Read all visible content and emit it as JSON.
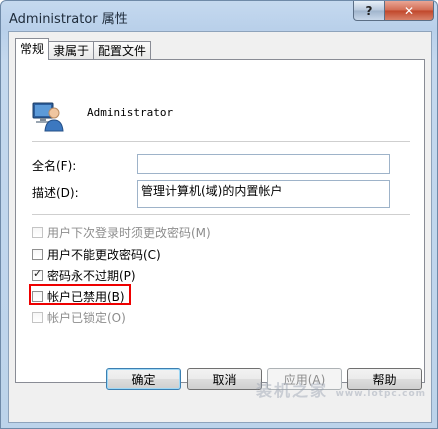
{
  "window": {
    "title": "Administrator 属性",
    "help_label": "?",
    "close_label": "✕"
  },
  "tabs": [
    {
      "label": "常规",
      "active": true
    },
    {
      "label": "隶属于",
      "active": false
    },
    {
      "label": "配置文件",
      "active": false
    }
  ],
  "user": {
    "name": "Administrator"
  },
  "form": {
    "fullname_label": "全名(F):",
    "fullname_value": "",
    "description_label": "描述(D):",
    "description_value": "管理计算机(域)的内置帐户"
  },
  "checkboxes": [
    {
      "label": "用户下次登录时须更改密码(M)",
      "checked": false,
      "disabled": true
    },
    {
      "label": "用户不能更改密码(C)",
      "checked": false,
      "disabled": false
    },
    {
      "label": "密码永不过期(P)",
      "checked": true,
      "disabled": false
    },
    {
      "label": "帐户已禁用(B)",
      "checked": false,
      "disabled": false
    },
    {
      "label": "帐户已锁定(O)",
      "checked": false,
      "disabled": true
    }
  ],
  "buttons": {
    "ok": "确定",
    "cancel": "取消",
    "apply": "应用(A)",
    "help": "帮助"
  },
  "watermark": {
    "text": "装机之家",
    "url": "www.lotpc.com"
  },
  "colors": {
    "highlight": "#e00000",
    "title_bar": "#c5d9ef",
    "close_button": "#c0462a"
  }
}
